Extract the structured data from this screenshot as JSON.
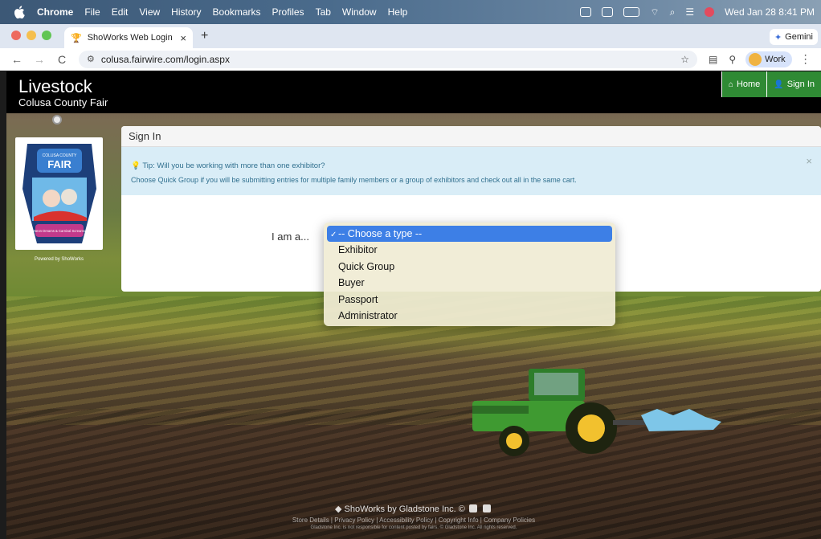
{
  "mac_menubar": {
    "app": "Chrome",
    "menus": [
      "File",
      "Edit",
      "View",
      "History",
      "Bookmarks",
      "Profiles",
      "Tab",
      "Window",
      "Help"
    ],
    "clock": "Wed Jan 28  8:41 PM"
  },
  "browser": {
    "tab": {
      "title": "ShoWorks Web Login",
      "close": "×"
    },
    "new_tab": "+",
    "gemini": "Gemini",
    "url": "colusa.fairwire.com/login.aspx",
    "profile": "Work",
    "back": "←",
    "forward": "→",
    "reload": "C"
  },
  "site": {
    "brand": "Livestock",
    "brand_sub": "Colusa County Fair",
    "nav": {
      "home": "Home",
      "signin": "Sign In"
    },
    "powered_by": "Powered by ShoWorks",
    "logo": {
      "line1": "COLUSA COUNTY",
      "line2": "FAIR",
      "line3": "Neon Dreams & Carnival Screams"
    }
  },
  "signin": {
    "heading": "Sign In",
    "tip_title": "Tip: Will you be working with more than one exhibitor?",
    "tip_body": "Choose Quick Group if you will be submitting entries for multiple family members or a group of exhibitors and check out all in the same cart.",
    "tip_close": "×",
    "type_label": "I am a...",
    "type_options": [
      "-- Choose a type --",
      "Exhibitor",
      "Quick Group",
      "Buyer",
      "Passport",
      "Administrator"
    ],
    "type_selected": "-- Choose a type --"
  },
  "footer": {
    "brand": "ShoWorks by Gladstone Inc. ©",
    "links": "Store Details  |  Privacy Policy  |  Accessibility Policy  |  Copyright Info  |  Company Policies",
    "copyright": "Gladstone Inc. is not responsible for content posted by fairs. © Gladstone Inc. All rights reserved."
  },
  "colors": {
    "navbar": "#000000",
    "nav_button": "#2f8a34",
    "alert_bg": "#d9edf7",
    "alert_text": "#31708f",
    "dropdown_highlight": "#3d7fe6"
  }
}
